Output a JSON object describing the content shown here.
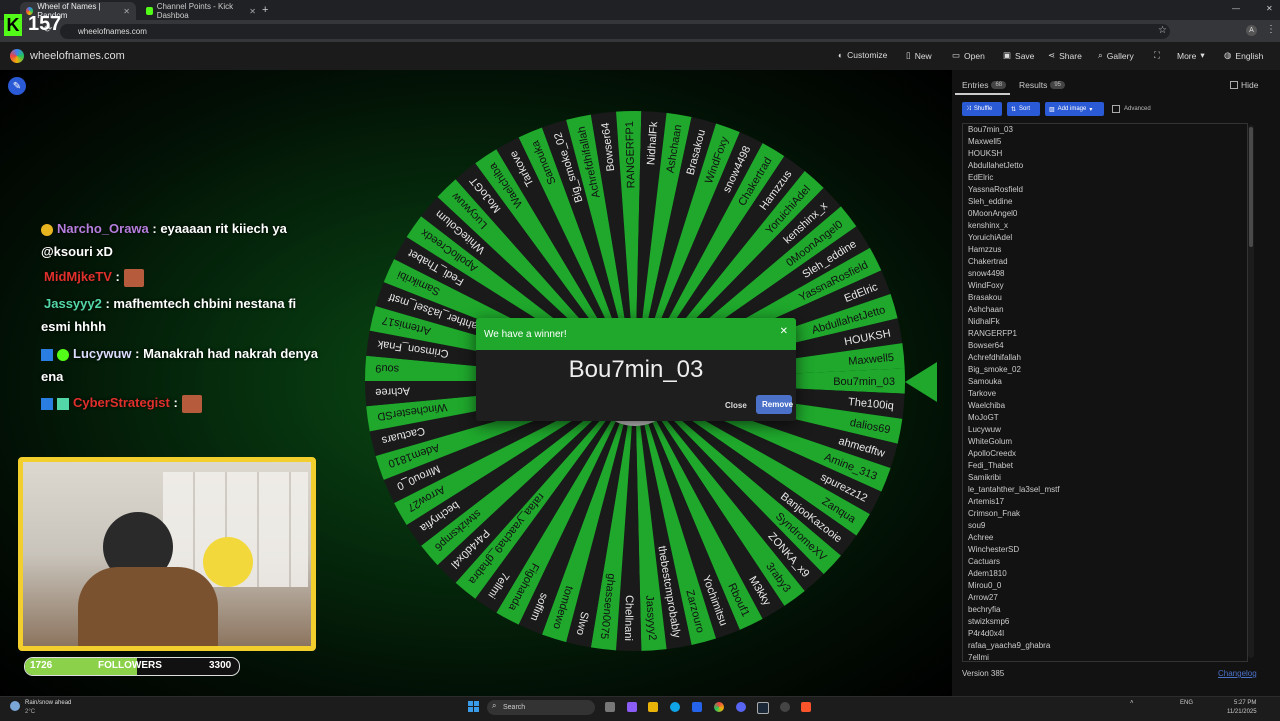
{
  "browser": {
    "tabs": [
      {
        "label": "Wheel of Names | Random",
        "active": true
      },
      {
        "label": "Channel Points - Kick Dashboa",
        "active": false
      }
    ],
    "url": "wheelofnames.com"
  },
  "stream": {
    "viewer_count": "157",
    "chat": [
      {
        "user": "Narcho_Orawa",
        "color": "#b57edc",
        "text": ": eyaaaan rit kiiech ya"
      },
      {
        "user": "",
        "color": "#ffffff",
        "text": "@ksouri xD"
      },
      {
        "user": "MidMjkeTV",
        "color": "#e0302c",
        "text": ":"
      },
      {
        "user": "Jassyyy2",
        "color": "#53d6a8",
        "text": ": mafhemtech chbini nestana fi"
      },
      {
        "user": "",
        "color": "#ffffff",
        "text": "esmi hhhh"
      },
      {
        "user": "Lucywuw",
        "color": "#dcdcff",
        "text": ": Manakrah had nakrah denya"
      },
      {
        "user": "",
        "color": "#ffffff",
        "text": "ena"
      },
      {
        "user": "CyberStrategist",
        "color": "#e0302c",
        "text": ":"
      }
    ],
    "followers": {
      "current": "1726",
      "label": "FOLLOWERS",
      "goal": "3300",
      "progress": 0.523
    }
  },
  "app": {
    "title": "wheelofnames.com",
    "menu": [
      "Customize",
      "New",
      "Open",
      "Save",
      "Share",
      "Gallery",
      "More",
      "English"
    ],
    "wheel_names": [
      "Bou7min_03",
      "The100iq",
      "dalios69",
      "ahmedftw",
      "Amine_313",
      "spurezz12",
      "Zanqua",
      "BanjooKazooie",
      "SyndromeXV",
      "ZONKA_x9",
      "3raby3",
      "M3kky",
      "Rbouf1",
      "Yochimitsu",
      "Zarzouro",
      "thebestcmprobably",
      "Jassyyy2",
      "Chellnani",
      "ghassen0075",
      "Slwo",
      "tomdewo",
      "soffim",
      "Figohanda",
      "7ellmi",
      "rafaa_yaacha9_ghabra",
      "P4r4d0x4l",
      "stwizksmp6",
      "bechryfia",
      "Arrow27",
      "Mirou0_0",
      "Adem1810",
      "Cactuars",
      "WinchesterSD",
      "Achree",
      "sou9",
      "Crimson_Fnak",
      "Artemis17",
      "le_tantahther_la3sel_mstf",
      "Samikribi",
      "Fedi_Thabet",
      "ApolloCreedx",
      "WhiteGolum",
      "Lucywuw",
      "MoJoGT",
      "Waelchiba",
      "Tarkove",
      "Samouka",
      "Big_smoke_02",
      "Achrefdhifallah",
      "Bowser64",
      "RANGERFP1",
      "NidhalFk",
      "Ashchaan",
      "Brasakou",
      "WindFoxy",
      "snow4498",
      "Chakertrad",
      "Hamzzus",
      "YoruichiAdel",
      "kenshinx_x",
      "0MoonAngel0",
      "Sleh_eddine",
      "YassnaRosfield",
      "EdElric",
      "AbdullahetJetto",
      "HOUKSH",
      "Maxwell5"
    ],
    "modal": {
      "title": "We have a winner!",
      "winner": "Bou7min_03",
      "close_label": "Close",
      "remove_label": "Remove"
    },
    "panel": {
      "entries_label": "Entries",
      "entries_count": "68",
      "results_label": "Results",
      "results_count": "95",
      "hide_label": "Hide",
      "shuffle_label": "Shuffle",
      "sort_label": "Sort",
      "add_image_label": "Add image",
      "advanced_label": "Advanced",
      "entries": [
        "Bou7min_03",
        "Maxwell5",
        "HOUKSH",
        "AbdullahetJetto",
        "EdElric",
        "YassnaRosfield",
        "Sleh_eddine",
        "0MoonAngel0",
        "kenshinx_x",
        "YoruichiAdel",
        "Hamzzus",
        "Chakertrad",
        "snow4498",
        "WindFoxy",
        "Brasakou",
        "Ashchaan",
        "NidhalFk",
        "RANGERFP1",
        "Bowser64",
        "Achrefdhifallah",
        "Big_smoke_02",
        "Samouka",
        "Tarkove",
        "Waelchiba",
        "MoJoGT",
        "Lucywuw",
        "WhiteGolum",
        "ApolloCreedx",
        "Fedi_Thabet",
        "Samikribi",
        "le_tantahther_la3sel_mstf",
        "Artemis17",
        "Crimson_Fnak",
        "sou9",
        "Achree",
        "WinchesterSD",
        "Cactuars",
        "Adem1810",
        "Mirou0_0",
        "Arrow27",
        "bechryfia",
        "stwizksmp6",
        "P4r4d0x4l",
        "rafaa_yaacha9_ghabra",
        "7ellmi"
      ],
      "version": "Version 385",
      "changelog": "Changelog"
    }
  },
  "taskbar": {
    "weather_line1": "Rain/snow ahead",
    "weather_line2": "2°C",
    "search_placeholder": "Search",
    "lang": "ENG",
    "time": "5:27 PM",
    "date": "11/21/2025"
  },
  "colors": {
    "wheel_green": "#1fa82c",
    "wheel_dark": "#1a1a1a",
    "accent_blue": "#2b5ad6"
  }
}
